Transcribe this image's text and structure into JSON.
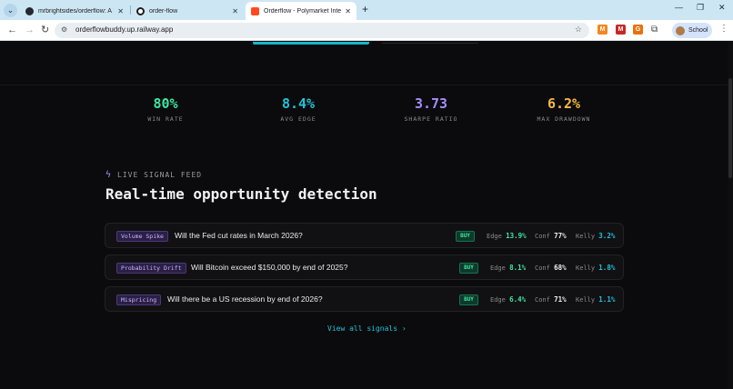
{
  "tabs": [
    {
      "title": "mrbrightsides/orderflow: A live",
      "favicon_color": "#24292f",
      "active": false
    },
    {
      "title": "order-flow",
      "favicon_color": "#1f1f1f",
      "active": false
    },
    {
      "title": "Orderflow - Polymarket Intellig",
      "favicon_color": "#ff4b1f",
      "active": true
    }
  ],
  "toolbar": {
    "url": "orderflowbuddy.up.railway.app",
    "profile_label": "School",
    "extensions": [
      {
        "name": "metamask-icon",
        "color": "#f6851b",
        "glyph": "M"
      },
      {
        "name": "extension-red-icon",
        "color": "#c62828",
        "glyph": "M"
      },
      {
        "name": "extension-orange-icon",
        "color": "#e8710a",
        "glyph": "G"
      }
    ]
  },
  "stats": [
    {
      "value": "80%",
      "label": "WIN RATE",
      "color": "#3ee6a0"
    },
    {
      "value": "8.4%",
      "label": "AVG EDGE",
      "color": "#21c3d6"
    },
    {
      "value": "3.73",
      "label": "SHARPE RATIO",
      "color": "#a58cff"
    },
    {
      "value": "6.2%",
      "label": "MAX DRAWDOWN",
      "color": "#f5b942"
    }
  ],
  "feed": {
    "label": "LIVE SIGNAL FEED",
    "headline": "Real-time opportunity detection",
    "view_all": "View all signals ›",
    "signals": [
      {
        "tag": "Volume Spike",
        "question": "Will the Fed cut rates in March 2026?",
        "action": "BUY",
        "edge_label": "Edge",
        "edge": "13.9%",
        "conf_label": "Conf",
        "conf": "77%",
        "kelly_label": "Kelly",
        "kelly": "3.2%"
      },
      {
        "tag": "Probability Drift",
        "question": "Will Bitcoin exceed $150,000 by end of 2025?",
        "action": "BUY",
        "edge_label": "Edge",
        "edge": "8.1%",
        "conf_label": "Conf",
        "conf": "68%",
        "kelly_label": "Kelly",
        "kelly": "1.8%"
      },
      {
        "tag": "Mispricing",
        "question": "Will there be a US recession by end of 2026?",
        "action": "BUY",
        "edge_label": "Edge",
        "edge": "6.4%",
        "conf_label": "Conf",
        "conf": "71%",
        "kelly_label": "Kelly",
        "kelly": "1.1%"
      }
    ]
  },
  "colors": {
    "edge": "#3ee6a0",
    "conf": "#f2f2f4",
    "kelly": "#21c3d6"
  }
}
